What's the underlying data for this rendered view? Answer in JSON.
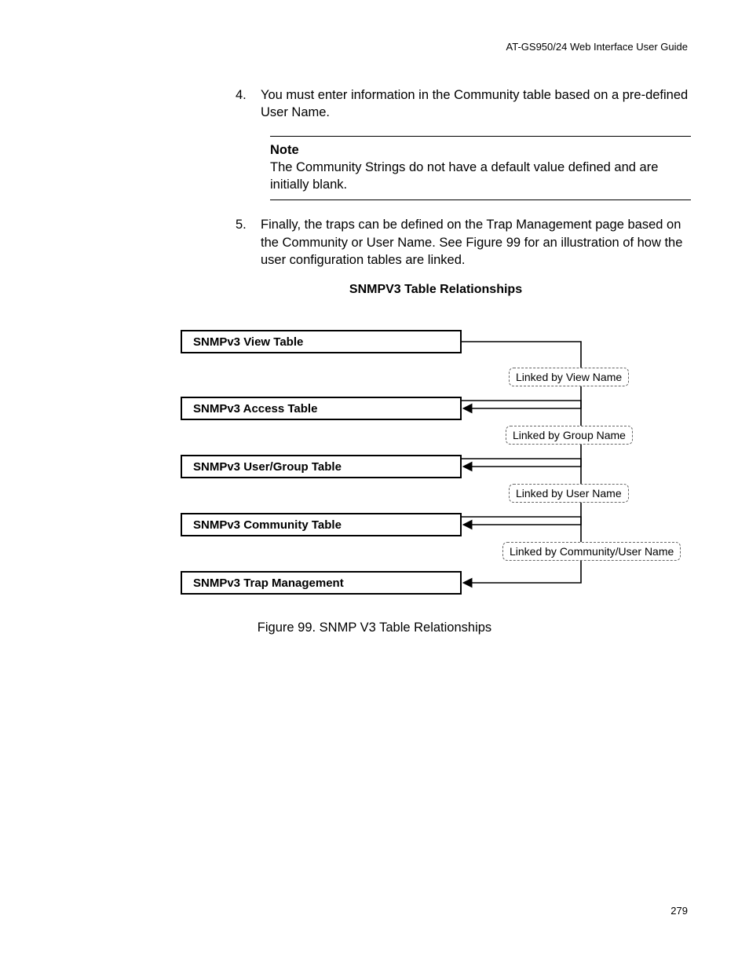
{
  "header": {
    "right": "AT-GS950/24  Web Interface User Guide"
  },
  "list": {
    "items": [
      {
        "num": "4.",
        "text": "You must enter information in the Community table based on a pre-defined User Name."
      },
      {
        "num": "5.",
        "text": "Finally, the traps can be defined on the Trap Management page based on the Community or User Name. See Figure 99 for an illustration of how the user configuration tables are linked."
      }
    ]
  },
  "note": {
    "title": "Note",
    "body": "The Community Strings do not have a default value defined and are initially blank."
  },
  "diagram": {
    "title": "SNMPV3 Table Relationships",
    "boxes": [
      "SNMPv3 View Table",
      "SNMPv3 Access Table",
      "SNMPv3 User/Group Table",
      "SNMPv3 Community Table",
      "SNMPv3 Trap Management"
    ],
    "links": [
      "Linked by View Name",
      "Linked by Group Name",
      "Linked by User Name",
      "Linked by Community/User Name"
    ]
  },
  "caption": "Figure 99. SNMP V3 Table Relationships",
  "page_number": "279"
}
